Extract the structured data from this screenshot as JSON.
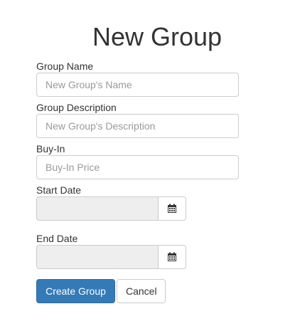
{
  "page": {
    "title": "New Group"
  },
  "form": {
    "group_name": {
      "label": "Group Name",
      "placeholder": "New Group's Name",
      "value": ""
    },
    "group_description": {
      "label": "Group Description",
      "placeholder": "New Group's Description",
      "value": ""
    },
    "buy_in": {
      "label": "Buy-In",
      "placeholder": "Buy-In Price",
      "value": ""
    },
    "start_date": {
      "label": "Start Date",
      "value": "",
      "icon": "calendar-icon"
    },
    "end_date": {
      "label": "End Date",
      "value": "",
      "icon": "calendar-icon"
    }
  },
  "actions": {
    "create_label": "Create Group",
    "cancel_label": "Cancel"
  },
  "colors": {
    "primary": "#337ab7",
    "primary_border": "#2e6da4",
    "disabled_input": "#eeeeee",
    "text": "#333333",
    "placeholder": "#999999"
  }
}
